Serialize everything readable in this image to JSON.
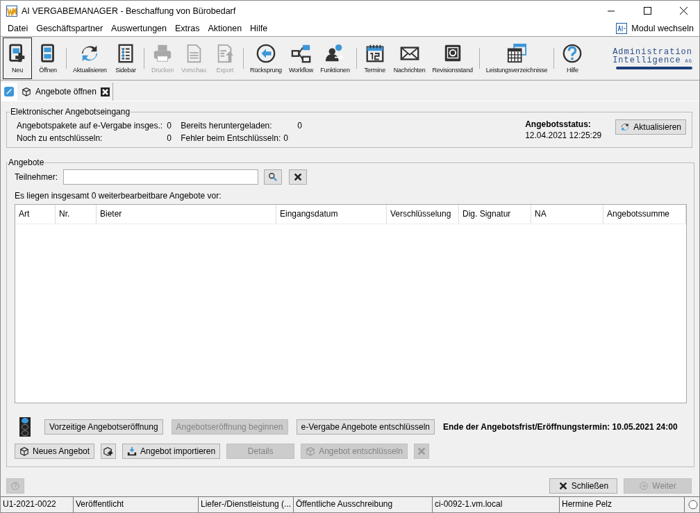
{
  "window": {
    "title": "AI VERGABEMANAGER - Beschaffung von Bürobedarf"
  },
  "menu": {
    "items": [
      "Datei",
      "Geschäftspartner",
      "Auswertungen",
      "Extras",
      "Aktionen",
      "Hilfe"
    ],
    "module_switch": "Modul wechseln"
  },
  "toolbar": {
    "groups": [
      [
        {
          "label": "Neu",
          "disabled": false,
          "selected": true
        },
        {
          "label": "Öffnen",
          "disabled": false,
          "selected": false
        }
      ],
      [
        {
          "label": "Aktualisieren",
          "disabled": false,
          "selected": false
        },
        {
          "label": "Sidebar",
          "disabled": false,
          "selected": false
        }
      ],
      [
        {
          "label": "Drucken",
          "disabled": true,
          "selected": false
        },
        {
          "label": "Vorschau",
          "disabled": true,
          "selected": false
        },
        {
          "label": "Export",
          "disabled": true,
          "selected": false
        }
      ],
      [
        {
          "label": "Rücksprung",
          "disabled": false,
          "selected": false
        },
        {
          "label": "Workflow",
          "disabled": false,
          "selected": false
        },
        {
          "label": "Funktionen",
          "disabled": false,
          "selected": false
        }
      ],
      [
        {
          "label": "Termine",
          "disabled": false,
          "selected": false
        },
        {
          "label": "Nachrichten",
          "disabled": false,
          "selected": false
        },
        {
          "label": "Revisionsstand",
          "disabled": false,
          "selected": false
        }
      ],
      [
        {
          "label": "Leistungsverzeichnisse",
          "disabled": false,
          "selected": false
        }
      ],
      [
        {
          "label": "Hilfe",
          "disabled": false,
          "selected": false
        }
      ]
    ],
    "logo": {
      "line1": "Administration",
      "line2": "Intelligence",
      "suffix": "AG"
    }
  },
  "tabs": [
    {
      "label": "Angebote öffnen",
      "selected": true
    }
  ],
  "inbox": {
    "title": "Elektronischer Angebotseingang",
    "stats": [
      {
        "label": "Angebotspakete auf e-Vergabe insges.:",
        "value": "0"
      },
      {
        "label": "Bereits heruntergeladen:",
        "value": "0"
      },
      {
        "label": "Noch zu entschlüsseln:",
        "value": "0"
      },
      {
        "label": "Fehler beim Entschlüsseln:",
        "value": "0"
      }
    ],
    "status_label": "Angebotsstatus:",
    "status_time": "12.04.2021 12:25:29",
    "refresh_button": "Aktualisieren"
  },
  "offers": {
    "title": "Angebote",
    "participant_label": "Teilnehmer:",
    "summary": "Es liegen insgesamt 0 weiterbearbeitbare Angebote vor:",
    "table": {
      "columns": [
        "Art",
        "Nr.",
        "Bieter",
        "Eingangsdatum",
        "Verschlüsselung",
        "Dig. Signatur",
        "NA",
        "Angebotssumme"
      ]
    },
    "traffic_light": {
      "lit": [
        true,
        false,
        false
      ]
    },
    "row1": [
      {
        "label": "Vorzeitige Angebotseröffnung",
        "disabled": false
      },
      {
        "label": "Angebotseröffnung beginnen",
        "disabled": true
      },
      {
        "label": "e-Vergabe Angebote entschlüsseln",
        "disabled": false
      }
    ],
    "deadline": "Ende der Angebotsfrist/Eröffnungstermin: 10.05.2021 24:00",
    "row2": [
      {
        "label": "Neues Angebot",
        "disabled": false
      },
      {
        "disabled": false
      },
      {
        "label": "Angebot importieren",
        "disabled": false
      },
      {
        "label": "Details",
        "disabled": true
      },
      {
        "label": "Angebot entschlüsseln",
        "disabled": true
      },
      {
        "disabled": true
      }
    ]
  },
  "footer": {
    "help_disabled": true,
    "close_button": {
      "label": "Schließen",
      "disabled": false
    },
    "next_button": {
      "label": "Weiter",
      "disabled": true
    }
  },
  "status_bar": [
    "U1-2021-0022",
    "Veröffentlicht",
    "Liefer-/Dienstleistung (...",
    "Öffentliche Ausschreibung",
    "ci-0092-1.vm.local",
    "Hermine Pelz"
  ]
}
